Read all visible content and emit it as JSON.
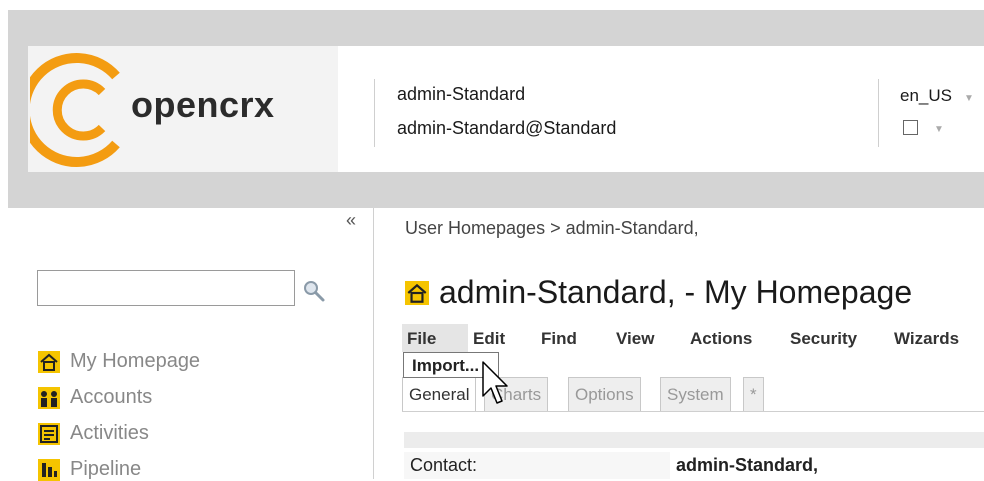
{
  "header": {
    "logo_text": "opencrx",
    "user_name": "admin-Standard",
    "user_email": "admin-Standard@Standard",
    "locale": "en_US",
    "brand_color": "#f39c12"
  },
  "sidebar": {
    "collapse_label": "«",
    "search": {
      "value": "",
      "placeholder": ""
    },
    "items": [
      {
        "label": "My Homepage",
        "icon": "home-icon"
      },
      {
        "label": "Accounts",
        "icon": "accounts-icon"
      },
      {
        "label": "Activities",
        "icon": "activities-icon"
      },
      {
        "label": "Pipeline",
        "icon": "pipeline-icon"
      }
    ]
  },
  "main": {
    "breadcrumb": "User Homepages > admin-Standard,",
    "title": "admin-Standard, - My Homepage",
    "menu": [
      "File",
      "Edit",
      "Find",
      "View",
      "Actions",
      "Security",
      "Wizards"
    ],
    "file_dropdown": [
      "Import..."
    ],
    "tabs": [
      "General",
      "Charts",
      "Options",
      "System",
      "*"
    ],
    "active_tab": "General",
    "fields": [
      {
        "label": "Contact:",
        "value": "admin-Standard,"
      }
    ]
  }
}
